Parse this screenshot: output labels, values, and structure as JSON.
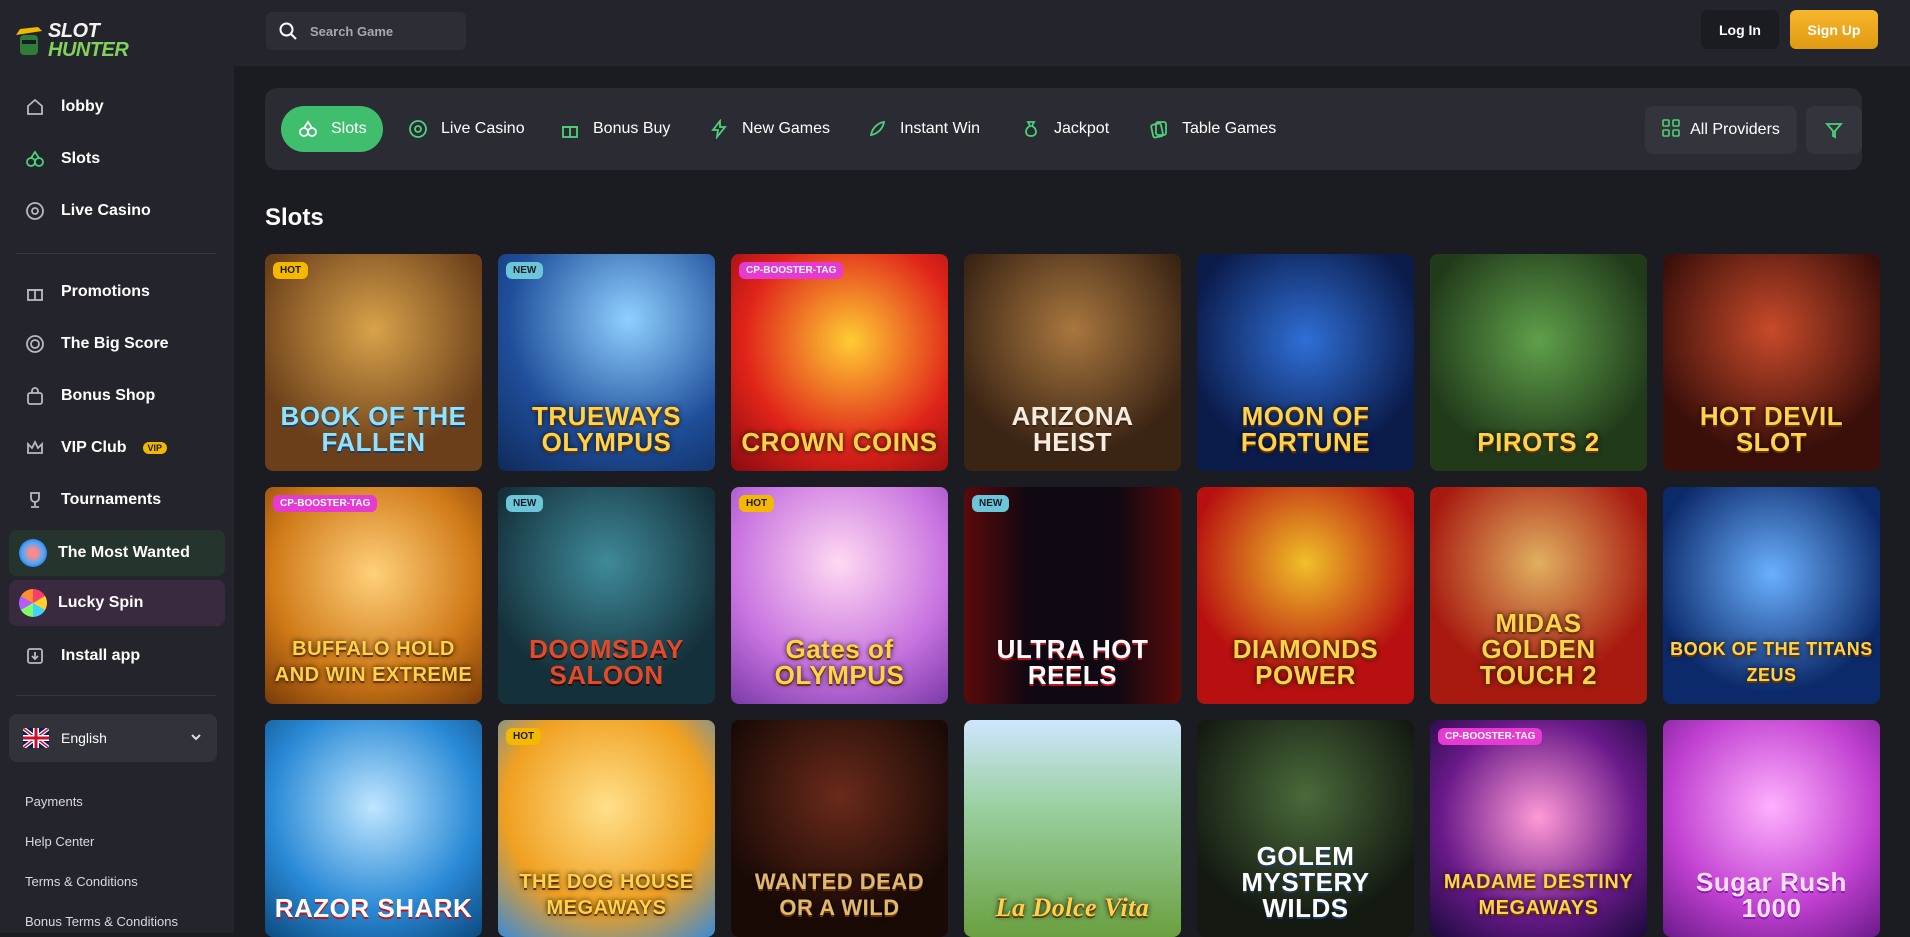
{
  "brand": {
    "line1": "SLOT",
    "line2": "HUNTER"
  },
  "header": {
    "search_placeholder": "Search Game",
    "login_label": "Log In",
    "signup_label": "Sign Up"
  },
  "sidebar": {
    "items_top": [
      {
        "label": "lobby",
        "icon": "home-icon"
      },
      {
        "label": "Slots",
        "icon": "slots-icon"
      },
      {
        "label": "Live Casino",
        "icon": "chip-icon"
      }
    ],
    "items_mid": [
      {
        "label": "Promotions",
        "icon": "gift-icon"
      },
      {
        "label": "The Big Score",
        "icon": "target-icon"
      },
      {
        "label": "Bonus Shop",
        "icon": "shopping-bag-icon"
      },
      {
        "label": "VIP Club",
        "icon": "crown-icon",
        "badge": "VIP"
      },
      {
        "label": "Tournaments",
        "icon": "trophy-icon"
      }
    ],
    "most_wanted": "The Most Wanted",
    "lucky_spin": "Lucky Spin",
    "install_app": "Install app",
    "language": "English",
    "footer_links": [
      "Payments",
      "Help Center",
      "Terms & Conditions",
      "Bonus Terms & Conditions"
    ]
  },
  "categories": [
    {
      "label": "Slots",
      "icon": "slots-icon",
      "active": true
    },
    {
      "label": "Live Casino",
      "icon": "chip-icon"
    },
    {
      "label": "Bonus Buy",
      "icon": "gift-icon"
    },
    {
      "label": "New Games",
      "icon": "lightning-icon"
    },
    {
      "label": "Instant Win",
      "icon": "rocket-icon"
    },
    {
      "label": "Jackpot",
      "icon": "money-bag-icon"
    },
    {
      "label": "Table Games",
      "icon": "cards-icon"
    }
  ],
  "providers_label": "All Providers",
  "section_title": "Slots",
  "games": [
    {
      "title": "BOOK OF THE FALLEN",
      "tag": "HOT"
    },
    {
      "title": "TRUEWAYS OLYMPUS",
      "tag": "NEW"
    },
    {
      "title": "CROWN COINS",
      "tag": "CP-BOOSTER-TAG"
    },
    {
      "title": "ARIZONA HEIST",
      "tag": ""
    },
    {
      "title": "MOON OF FORTUNE",
      "tag": ""
    },
    {
      "title": "PIROTS 2",
      "tag": ""
    },
    {
      "title": "HOT DEVIL SLOT",
      "tag": ""
    },
    {
      "title": "BUFFALO HOLD AND WIN EXTREME",
      "tag": "CP-BOOSTER-TAG"
    },
    {
      "title": "DOOMSDAY SALOON",
      "tag": "NEW"
    },
    {
      "title": "Gates of OLYMPUS",
      "tag": "HOT"
    },
    {
      "title": "ULTRA HOT REELS",
      "tag": "NEW"
    },
    {
      "title": "DIAMONDS POWER",
      "tag": ""
    },
    {
      "title": "MIDAS GOLDEN TOUCH 2",
      "tag": ""
    },
    {
      "title": "BOOK OF THE TITANS ZEUS",
      "tag": ""
    },
    {
      "title": "RAZOR SHARK",
      "tag": ""
    },
    {
      "title": "THE DOG HOUSE MEGAWAYS",
      "tag": "HOT"
    },
    {
      "title": "WANTED DEAD OR A WILD",
      "tag": ""
    },
    {
      "title": "La Dolce Vita",
      "tag": ""
    },
    {
      "title": "GOLEM MYSTERY WILDS",
      "tag": ""
    },
    {
      "title": "MADAME DESTINY MEGAWAYS",
      "tag": "CP-BOOSTER-TAG"
    },
    {
      "title": "Sugar Rush 1000",
      "tag": ""
    }
  ],
  "colors": {
    "accent": "#3fbf6d",
    "signup": "#f0a81c",
    "bg": "#1b1c22",
    "panel": "#24252c"
  }
}
